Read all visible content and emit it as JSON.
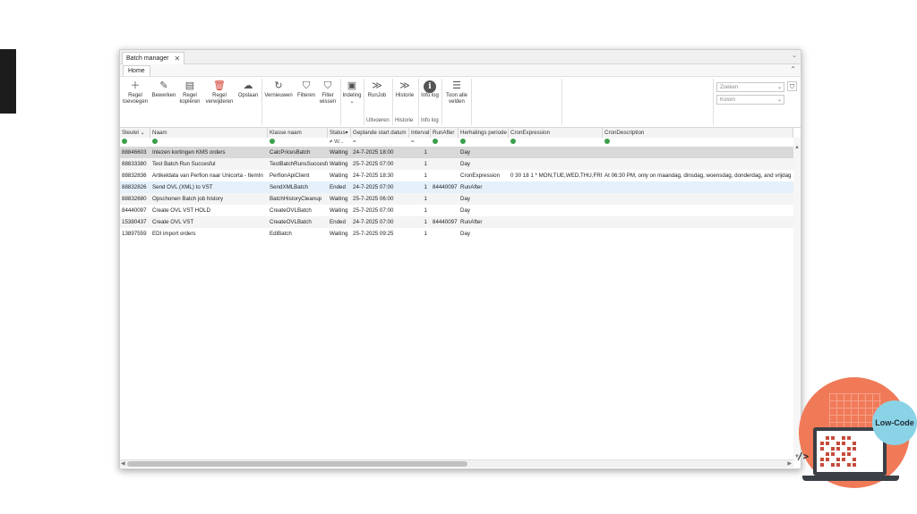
{
  "window": {
    "tab_title": "Batch manager",
    "ribbon_tab": "Home"
  },
  "ribbon": {
    "buttons": [
      {
        "label": "Regel toevoegen"
      },
      {
        "label": "Bewerken"
      },
      {
        "label": "Regel kopiëren"
      },
      {
        "label": "Regel verwijderen"
      },
      {
        "label": "Opslaan"
      },
      {
        "label": "Vernieuwen"
      },
      {
        "label": "Filteren"
      },
      {
        "label": "Filter wissen"
      },
      {
        "label": "Indeling"
      },
      {
        "label": "RunJob"
      },
      {
        "label": "Historie"
      },
      {
        "label": "Info log"
      },
      {
        "label": "Toon alle velden"
      }
    ],
    "groups": {
      "uitvoeren": "Uitvoeren",
      "historie": "Historie",
      "info_log": "Info log"
    },
    "search_placeholder": "Zoeken",
    "kolom_placeholder": "Kolom"
  },
  "grid": {
    "columns": [
      "Sleutel",
      "Naam",
      "Klasse naam",
      "Status",
      "Geplande start datum",
      "Interval",
      "RunAfter",
      "Herhalings periode",
      "CronExpression",
      "CronDescription"
    ],
    "filters": {
      "status": "≠ W...",
      "planned": "=",
      "interval": "="
    },
    "rows": [
      [
        "88846603",
        "Inlezen kortingen KMS orders",
        "CalcPricesBatch",
        "Waiting",
        "24-7-2025 18:00",
        "1",
        "",
        "Day",
        "",
        ""
      ],
      [
        "88833380",
        "Test Batch Run Succesful",
        "TestBatchRunsSuccesful",
        "Waiting",
        "25-7-2025 07:00",
        "1",
        "",
        "Day",
        "",
        ""
      ],
      [
        "88832836",
        "Artikeldata van Perfion naar Unicorta - ItemIn",
        "PerfionApiClient",
        "Waiting",
        "24-7-2025 18:30",
        "1",
        "",
        "CronExpression",
        "0 30 18 1 * MON,TUE,WED,THU,FRI *",
        "At 06:30 PM, only on maandag, dinsdag, woensdag, donderdag, and vrijdag"
      ],
      [
        "88832826",
        "Send OVL (XML) to VST",
        "SendXMLBatch",
        "Ended",
        "24-7-2025 07:00",
        "1",
        "84440097",
        "RunAfter",
        "",
        ""
      ],
      [
        "88832680",
        "Opschonen Batch job history",
        "BatchHistoryCleanup",
        "Waiting",
        "25-7-2025 06:00",
        "1",
        "",
        "Day",
        "",
        ""
      ],
      [
        "84440097",
        "Create OVL VST HOLD",
        "CreateOVLBatch",
        "Waiting",
        "25-7-2025 07:00",
        "1",
        "",
        "Day",
        "",
        ""
      ],
      [
        "15380437",
        "Create OVL VST",
        "CreateOVLBatch",
        "Ended",
        "24-7-2025 07:00",
        "1",
        "84440097",
        "RunAfter",
        "",
        ""
      ],
      [
        "13897559",
        "EDI import orders",
        "EdiBatch",
        "Waiting",
        "25-7-2025 09:25",
        "1",
        "",
        "Day",
        "",
        ""
      ]
    ]
  },
  "logo": {
    "badge": "Low-Code",
    "code_tag": "/>"
  }
}
